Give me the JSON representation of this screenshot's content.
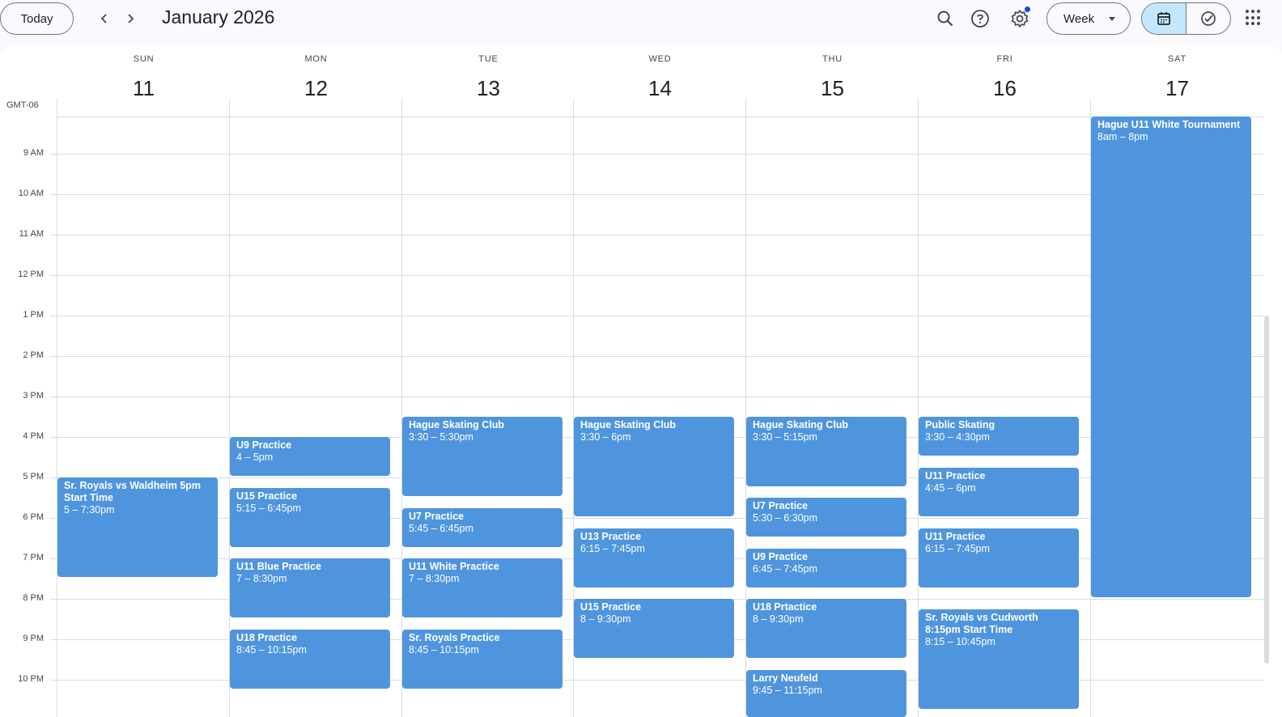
{
  "header": {
    "today_label": "Today",
    "title": "January 2026",
    "view_label": "Week",
    "timezone": "GMT-06"
  },
  "icons": [
    "chevron-left-icon",
    "chevron-right-icon",
    "search-icon",
    "help-icon",
    "settings-icon",
    "calendar-icon",
    "tasks-icon",
    "apps-icon"
  ],
  "colors": {
    "event": "#4f95de",
    "accent": "#0b57d0",
    "selected": "#c2e7ff"
  },
  "days": [
    {
      "dow": "SUN",
      "num": "11"
    },
    {
      "dow": "MON",
      "num": "12"
    },
    {
      "dow": "TUE",
      "num": "13"
    },
    {
      "dow": "WED",
      "num": "14"
    },
    {
      "dow": "THU",
      "num": "15"
    },
    {
      "dow": "FRI",
      "num": "16"
    },
    {
      "dow": "SAT",
      "num": "17"
    }
  ],
  "hours": [
    "9 AM",
    "10 AM",
    "11 AM",
    "12 PM",
    "1 PM",
    "2 PM",
    "3 PM",
    "4 PM",
    "5 PM",
    "6 PM",
    "7 PM",
    "8 PM",
    "9 PM",
    "10 PM"
  ],
  "events": [
    {
      "day": 0,
      "start": 17.0,
      "end": 19.5,
      "title": "Sr. Royals vs Waldheim 5pm Start Time",
      "time": "5 – 7:30pm"
    },
    {
      "day": 1,
      "start": 16.0,
      "end": 17.0,
      "title": "U9 Practice",
      "time": "4 – 5pm"
    },
    {
      "day": 1,
      "start": 17.25,
      "end": 18.75,
      "title": "U15 Practice",
      "time": "5:15 – 6:45pm"
    },
    {
      "day": 1,
      "start": 19.0,
      "end": 20.5,
      "title": "U11 Blue Practice",
      "time": "7 – 8:30pm"
    },
    {
      "day": 1,
      "start": 20.75,
      "end": 22.25,
      "title": "U18 Practice",
      "time": "8:45 – 10:15pm"
    },
    {
      "day": 2,
      "start": 15.5,
      "end": 17.5,
      "title": "Hague Skating Club",
      "time": "3:30 – 5:30pm"
    },
    {
      "day": 2,
      "start": 17.75,
      "end": 18.75,
      "title": "U7 Practice",
      "time": "5:45 – 6:45pm"
    },
    {
      "day": 2,
      "start": 19.0,
      "end": 20.5,
      "title": "U11 White Practice",
      "time": "7 – 8:30pm"
    },
    {
      "day": 2,
      "start": 20.75,
      "end": 22.25,
      "title": "Sr. Royals Practice",
      "time": "8:45 – 10:15pm"
    },
    {
      "day": 3,
      "start": 15.5,
      "end": 18.0,
      "title": "Hague Skating Club",
      "time": "3:30 – 6pm"
    },
    {
      "day": 3,
      "start": 18.25,
      "end": 19.75,
      "title": "U13 Practice",
      "time": "6:15 – 7:45pm"
    },
    {
      "day": 3,
      "start": 20.0,
      "end": 21.5,
      "title": "U15 Practice",
      "time": "8 – 9:30pm"
    },
    {
      "day": 4,
      "start": 15.5,
      "end": 17.25,
      "title": "Hague Skating Club",
      "time": "3:30 – 5:15pm"
    },
    {
      "day": 4,
      "start": 17.5,
      "end": 18.5,
      "title": "U7 Practice",
      "time": "5:30 – 6:30pm"
    },
    {
      "day": 4,
      "start": 18.75,
      "end": 19.75,
      "title": "U9 Practice",
      "time": "6:45 – 7:45pm"
    },
    {
      "day": 4,
      "start": 20.0,
      "end": 21.5,
      "title": "U18 Prtactice",
      "time": "8 – 9:30pm"
    },
    {
      "day": 4,
      "start": 21.75,
      "end": 23.25,
      "title": "Larry Neufeld",
      "time": "9:45 – 11:15pm"
    },
    {
      "day": 5,
      "start": 15.5,
      "end": 16.5,
      "title": "Public Skating",
      "time": "3:30 – 4:30pm"
    },
    {
      "day": 5,
      "start": 16.75,
      "end": 18.0,
      "title": "U11 Practice",
      "time": "4:45 – 6pm"
    },
    {
      "day": 5,
      "start": 18.25,
      "end": 19.75,
      "title": "U11 Practice",
      "time": "6:15 – 7:45pm"
    },
    {
      "day": 5,
      "start": 20.25,
      "end": 22.75,
      "title": "Sr. Royals vs Cudworth 8:15pm Start Time",
      "time": "8:15 – 10:45pm"
    },
    {
      "day": 6,
      "start": 8.0,
      "end": 20.0,
      "title": "Hague U11 White Tournament",
      "time": "8am – 8pm"
    }
  ]
}
